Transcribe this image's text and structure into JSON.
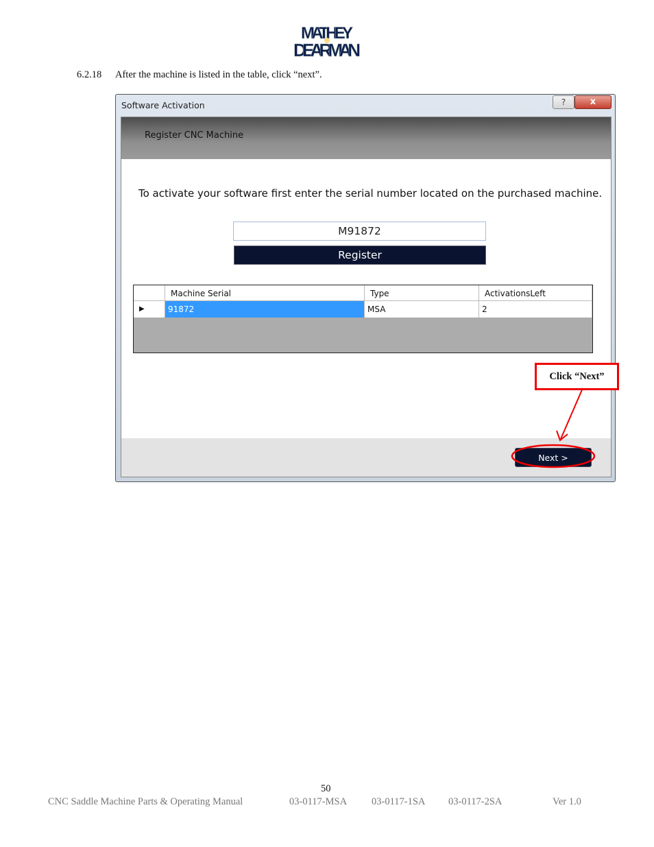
{
  "logo": {
    "text": "MATHEY DEARMAN"
  },
  "step": {
    "number": "6.2.18",
    "text": "After the machine is listed in the table, click “next”."
  },
  "window": {
    "title": "Software Activation",
    "help_label": "?",
    "close_label": "x",
    "header": "Register CNC Machine",
    "instruction": "To activate your software first enter the serial number located on the purchased machine.",
    "serial_value": "M91872",
    "register_label": "Register",
    "grid": {
      "columns": [
        "Machine Serial",
        "Type",
        "ActivationsLeft"
      ],
      "rows": [
        {
          "serial": "91872",
          "type": "MSA",
          "activations": "2"
        }
      ]
    },
    "next_label": "Next  >"
  },
  "annotation": {
    "callout": "Click “Next”",
    "color": "#e00000"
  },
  "page_footer": {
    "page_number": "50",
    "manual": "CNC Saddle Machine Parts & Operating Manual",
    "codes": [
      "03-0117-MSA",
      "03-0117-1SA",
      "03-0117-2SA"
    ],
    "version": "Ver 1.0"
  }
}
